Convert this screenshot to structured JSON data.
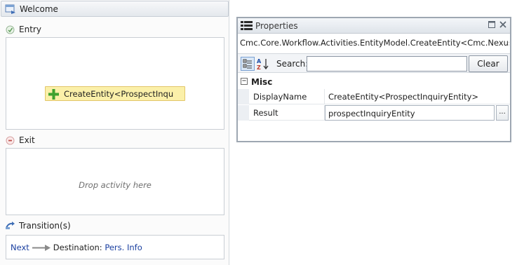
{
  "state": {
    "title": "Welcome",
    "entry_label": "Entry",
    "exit_label": "Exit",
    "transitions_label": "Transition(s)",
    "entry_activity": "CreateEntity<ProspectInqu",
    "exit_drop_hint": "Drop activity here",
    "transition": {
      "name": "Next",
      "destination_label": "Destination:",
      "destination": "Pers. Info"
    }
  },
  "properties": {
    "title": "Properties",
    "type_name": "Cmc.Core.Workflow.Activities.EntityModel.CreateEntity<Cmc.Nexus.A...",
    "search_label": "Search:",
    "search_value": "",
    "clear_label": "Clear",
    "category": {
      "toggle": "−",
      "name": "Misc"
    },
    "rows": [
      {
        "name": "DisplayName",
        "value": "CreateEntity<ProspectInquiryEntity>"
      },
      {
        "name": "Result",
        "value": "prospectInquiryEntity",
        "button": "..."
      }
    ]
  },
  "colors": {
    "activity_fill": "#fbf0a9",
    "link": "#1a3fa0",
    "window_border": "#9ea7b2"
  },
  "icons": [
    "state-icon",
    "entry-icon",
    "exit-icon",
    "transition-icon",
    "add-activity-icon",
    "properties-icon",
    "categorized-icon",
    "alphabetical-sort-icon",
    "dock-icon",
    "close-icon",
    "arrow-icon"
  ]
}
